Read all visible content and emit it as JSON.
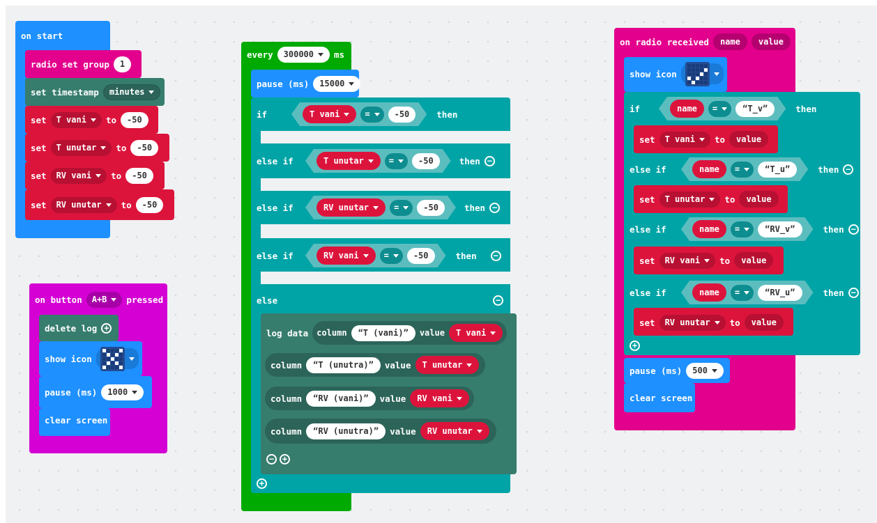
{
  "colors": {
    "basic": "#1e90ff",
    "radio": "#e3008c",
    "variables": "#dc143c",
    "log": "#377d6e",
    "logic": "#00a4a6",
    "loops": "#00aa00",
    "input": "#d400d4",
    "compare": "#5c81a6"
  },
  "on_start": {
    "label": "on start",
    "radio_set_group": "radio set group",
    "group_value": "1",
    "set_timestamp": "set timestamp",
    "timestamp_unit": "minutes",
    "sets": [
      {
        "set": "set",
        "var": "T vani",
        "to": "to",
        "value": "-50"
      },
      {
        "set": "set",
        "var": "T unutar",
        "to": "to",
        "value": "-50"
      },
      {
        "set": "set",
        "var": "RV vani",
        "to": "to",
        "value": "-50"
      },
      {
        "set": "set",
        "var": "RV unutar",
        "to": "to",
        "value": "-50"
      }
    ]
  },
  "on_button": {
    "label_on": "on button",
    "button": "A+B",
    "label_pressed": "pressed",
    "delete_log": "delete log",
    "show_icon": "show icon",
    "pause": "pause (ms)",
    "pause_value": "1000",
    "clear_screen": "clear screen"
  },
  "every": {
    "label": "every",
    "interval": "300000",
    "unit": "ms",
    "pause": "pause (ms)",
    "pause_value": "15000",
    "if": "if",
    "else_if": "else if",
    "else": "else",
    "then": "then",
    "conditions": [
      {
        "var": "T vani",
        "op": "=",
        "value": "-50"
      },
      {
        "var": "T unutar",
        "op": "=",
        "value": "-50"
      },
      {
        "var": "RV unutar",
        "op": "=",
        "value": "-50"
      },
      {
        "var": "RV vani",
        "op": "=",
        "value": "-50"
      }
    ],
    "log_data": "log data",
    "columns": [
      {
        "column": "column",
        "name": "T (vani)",
        "value_label": "value",
        "var": "T vani"
      },
      {
        "column": "column",
        "name": "T (unutra)",
        "value_label": "value",
        "var": "T unutar"
      },
      {
        "column": "column",
        "name": "RV (vani)",
        "value_label": "value",
        "var": "RV vani"
      },
      {
        "column": "column",
        "name": "RV (unutra)",
        "value_label": "value",
        "var": "RV unutar"
      }
    ]
  },
  "on_radio": {
    "label": "on radio received",
    "param_name": "name",
    "param_value": "value",
    "show_icon": "show icon",
    "if": "if",
    "else_if": "else if",
    "then": "then",
    "set": "set",
    "to": "to",
    "branches": [
      {
        "name": "name",
        "op": "=",
        "text": "T_v",
        "var": "T vani",
        "value": "value"
      },
      {
        "name": "name",
        "op": "=",
        "text": "T_u",
        "var": "T unutar",
        "value": "value"
      },
      {
        "name": "name",
        "op": "=",
        "text": "RV_v",
        "var": "RV vani",
        "value": "value"
      },
      {
        "name": "name",
        "op": "=",
        "text": "RV_u",
        "var": "RV unutar",
        "value": "value"
      }
    ],
    "pause": "pause (ms)",
    "pause_value": "500",
    "clear_screen": "clear screen"
  }
}
